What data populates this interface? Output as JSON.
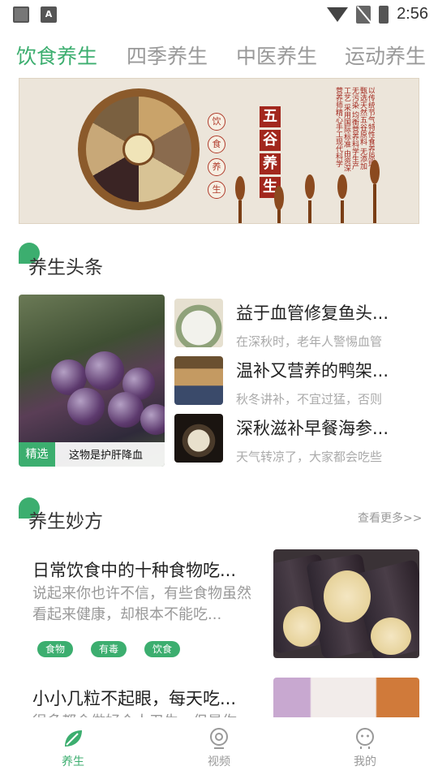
{
  "status_bar": {
    "time": "2:56"
  },
  "tabs": [
    {
      "label": "饮食养生",
      "active": true
    },
    {
      "label": "四季养生",
      "active": false
    },
    {
      "label": "中医养生",
      "active": false
    },
    {
      "label": "运动养生",
      "active": false
    }
  ],
  "banner": {
    "side_label": [
      "饮",
      "食",
      "养",
      "生"
    ],
    "title_chars": [
      "五",
      "谷",
      "养",
      "生"
    ],
    "body_text": "以传统节气特性食养原理 甄选天然五谷原料 无添加无污染 均衡营养科学生产工艺 采用国际标准 由资深营养师精心手工现代科学"
  },
  "headlines": {
    "section_title": "养生头条",
    "feature": {
      "tag": "精选",
      "caption": "这物是护肝降血"
    },
    "items": [
      {
        "title": "益于血管修复鱼头...",
        "subtitle": "在深秋时，老年人警惕血管"
      },
      {
        "title": "温补又营养的鸭架...",
        "subtitle": "秋冬讲补，不宜过猛，否则"
      },
      {
        "title": "深秋滋补早餐海参...",
        "subtitle": "天气转凉了，大家都会吃些"
      }
    ]
  },
  "recipes": {
    "section_title": "养生妙方",
    "more_label": "查看更多>>",
    "items": [
      {
        "title": "日常饮食中的十种食物吃...",
        "description": "说起来你也许不信，有些食物虽然看起来健康，却根本不能吃...",
        "tags": [
          "食物",
          "有毒",
          "饮食"
        ]
      },
      {
        "title": "小小几粒不起眼，每天吃...",
        "description": "很多都会做好个人卫生，但是你",
        "tags": []
      }
    ]
  },
  "bottom_nav": [
    {
      "label": "养生",
      "icon": "leaf-icon",
      "active": true
    },
    {
      "label": "视频",
      "icon": "video-camera-icon",
      "active": false
    },
    {
      "label": "我的",
      "icon": "profile-icon",
      "active": false
    }
  ],
  "colors": {
    "accent": "#3cae6f",
    "muted_text": "#999999",
    "title_text": "#222222"
  }
}
